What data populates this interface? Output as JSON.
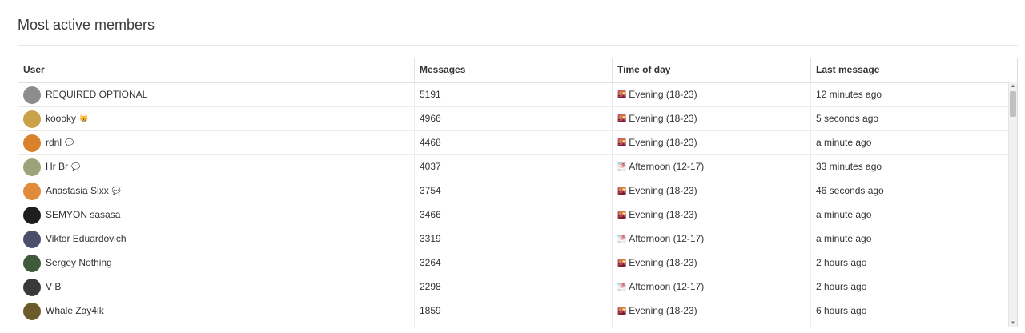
{
  "page": {
    "title": "Most active members"
  },
  "table": {
    "columns": [
      "User",
      "Messages",
      "Time of day",
      "Last message"
    ],
    "rows": [
      {
        "user": "REQUIRED OPTIONAL",
        "badge": "",
        "messages": "5191",
        "tod_icon": "🌇",
        "time_of_day": "Evening (18-23)",
        "last_message": "12 minutes ago",
        "avatar_color": "#8c8c8c"
      },
      {
        "user": "koooky",
        "badge": "😸",
        "messages": "4966",
        "tod_icon": "🌇",
        "time_of_day": "Evening (18-23)",
        "last_message": "5 seconds ago",
        "avatar_color": "#c9a24a"
      },
      {
        "user": "rdnl",
        "badge": "💬",
        "messages": "4468",
        "tod_icon": "🌇",
        "time_of_day": "Evening (18-23)",
        "last_message": "a minute ago",
        "avatar_color": "#d9822b"
      },
      {
        "user": "Hr Br",
        "badge": "💬",
        "messages": "4037",
        "tod_icon": "🌁",
        "time_of_day": "Afternoon (12-17)",
        "last_message": "33 minutes ago",
        "avatar_color": "#9aa37a"
      },
      {
        "user": "Anastasia Sixx",
        "badge": "💬",
        "messages": "3754",
        "tod_icon": "🌇",
        "time_of_day": "Evening (18-23)",
        "last_message": "46 seconds ago",
        "avatar_color": "#e08a3a"
      },
      {
        "user": "SEMYON sasasa",
        "badge": "",
        "messages": "3466",
        "tod_icon": "🌇",
        "time_of_day": "Evening (18-23)",
        "last_message": "a minute ago",
        "avatar_color": "#1e1e1e"
      },
      {
        "user": "Viktor Eduardovich",
        "badge": "",
        "messages": "3319",
        "tod_icon": "🌁",
        "time_of_day": "Afternoon (12-17)",
        "last_message": "a minute ago",
        "avatar_color": "#4a4f6b"
      },
      {
        "user": "Sergey Nothing",
        "badge": "",
        "messages": "3264",
        "tod_icon": "🌇",
        "time_of_day": "Evening (18-23)",
        "last_message": "2 hours ago",
        "avatar_color": "#3f5a3a"
      },
      {
        "user": "V B",
        "badge": "",
        "messages": "2298",
        "tod_icon": "🌁",
        "time_of_day": "Afternoon (12-17)",
        "last_message": "2 hours ago",
        "avatar_color": "#3a3a3a"
      },
      {
        "user": "Whale Zay4ik",
        "badge": "",
        "messages": "1859",
        "tod_icon": "🌇",
        "time_of_day": "Evening (18-23)",
        "last_message": "6 hours ago",
        "avatar_color": "#6b5a2a"
      },
      {
        "user": "",
        "badge": "",
        "messages": "",
        "tod_icon": "",
        "time_of_day": "",
        "last_message": "",
        "avatar_color": "#a0735a"
      }
    ]
  },
  "scrollbar": {
    "up_arrow": "▲",
    "down_arrow": "▼"
  }
}
